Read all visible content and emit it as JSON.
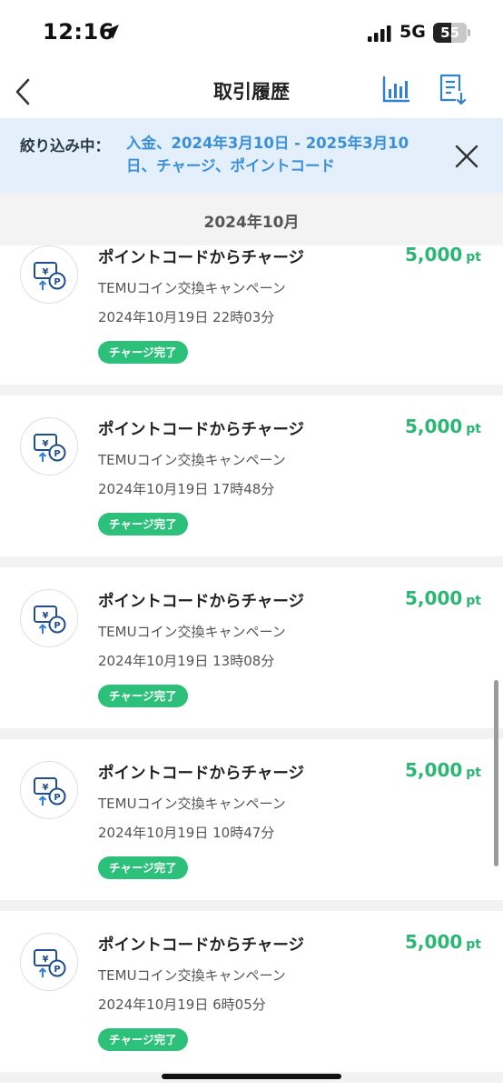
{
  "status_bar": {
    "time": "12:16",
    "network": "5G",
    "battery": "55",
    "battery_level": 0.55
  },
  "header": {
    "title": "取引履歴",
    "back_icon": "chevron-left-icon",
    "chart_icon": "bar-chart-icon",
    "export_icon": "document-download-icon"
  },
  "filter": {
    "label": "絞り込み中：",
    "text": "入金、2024年3月10日 - 2025年3月10日、チャージ、ポイントコード",
    "close_icon": "close-icon"
  },
  "month": "2024年10月",
  "transactions": [
    {
      "title": "ポイントコードからチャージ",
      "campaign": "TEMUコイン交換キャンペーン",
      "datetime": "2024年10月19日 22時03分",
      "status": "チャージ完了",
      "amount": "5,000",
      "unit": "pt"
    },
    {
      "title": "ポイントコードからチャージ",
      "campaign": "TEMUコイン交換キャンペーン",
      "datetime": "2024年10月19日 17時48分",
      "status": "チャージ完了",
      "amount": "5,000",
      "unit": "pt"
    },
    {
      "title": "ポイントコードからチャージ",
      "campaign": "TEMUコイン交換キャンペーン",
      "datetime": "2024年10月19日 13時08分",
      "status": "チャージ完了",
      "amount": "5,000",
      "unit": "pt"
    },
    {
      "title": "ポイントコードからチャージ",
      "campaign": "TEMUコイン交換キャンペーン",
      "datetime": "2024年10月19日 10時47分",
      "status": "チャージ完了",
      "amount": "5,000",
      "unit": "pt"
    },
    {
      "title": "ポイントコードからチャージ",
      "campaign": "TEMUコイン交換キャンペーン",
      "datetime": "2024年10月19日 6時05分",
      "status": "チャージ完了",
      "amount": "5,000",
      "unit": "pt"
    }
  ],
  "colors": {
    "accent": "#3b8fd9",
    "amount": "#2bb673",
    "badge": "#2cc07a",
    "filter_bg": "#e3f0fc"
  }
}
